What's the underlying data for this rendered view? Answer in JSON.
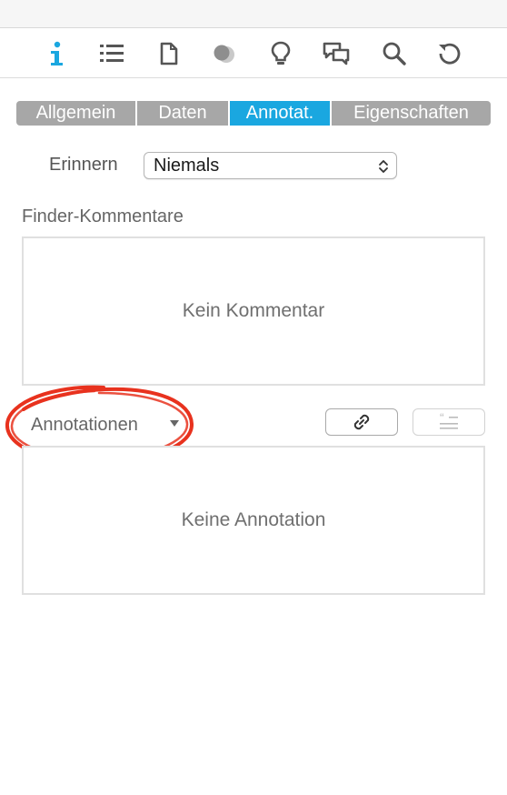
{
  "toolbar": {
    "icons": [
      "info-icon",
      "list-icon",
      "document-icon",
      "overlap-circles-icon",
      "lightbulb-icon",
      "chat-bubbles-icon",
      "search-icon",
      "refresh-icon"
    ],
    "active_index": 0,
    "active_color": "#1aa7e0",
    "icon_color": "#555555"
  },
  "tabs": [
    {
      "label": "Allgemein",
      "active": false
    },
    {
      "label": "Daten",
      "active": false
    },
    {
      "label": "Annotat.",
      "active": true
    },
    {
      "label": "Eigenschaften",
      "active": false
    }
  ],
  "remind": {
    "label": "Erinnern",
    "value": "Niemals"
  },
  "finder_comments": {
    "label": "Finder-Kommentare",
    "empty_text": "Kein Kommentar"
  },
  "annotations": {
    "label": "Annotationen",
    "empty_text": "Keine Annotation",
    "link_button_icon": "link-icon",
    "quote_button_icon": "quote-icon",
    "highlight_color": "#e8321e"
  }
}
